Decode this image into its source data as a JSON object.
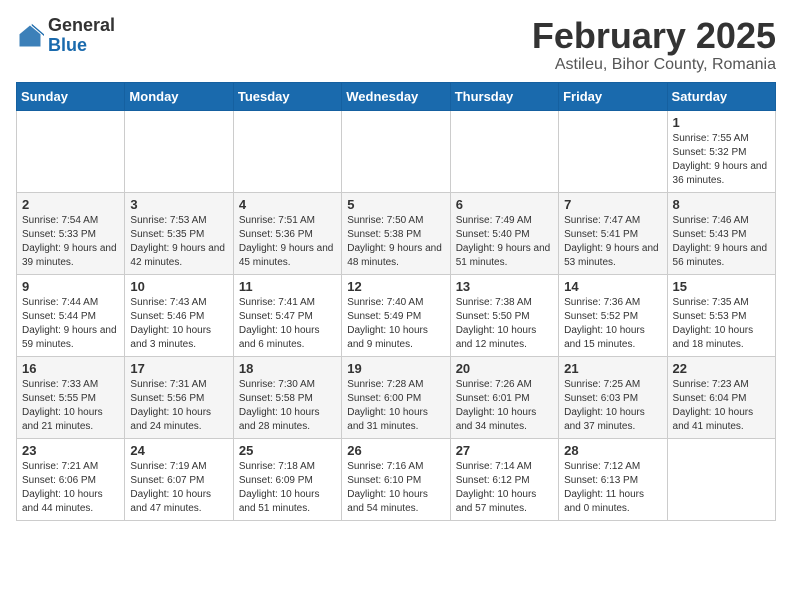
{
  "header": {
    "logo_general": "General",
    "logo_blue": "Blue",
    "month_title": "February 2025",
    "location": "Astileu, Bihor County, Romania"
  },
  "weekdays": [
    "Sunday",
    "Monday",
    "Tuesday",
    "Wednesday",
    "Thursday",
    "Friday",
    "Saturday"
  ],
  "weeks": [
    [
      {
        "day": "",
        "info": ""
      },
      {
        "day": "",
        "info": ""
      },
      {
        "day": "",
        "info": ""
      },
      {
        "day": "",
        "info": ""
      },
      {
        "day": "",
        "info": ""
      },
      {
        "day": "",
        "info": ""
      },
      {
        "day": "1",
        "info": "Sunrise: 7:55 AM\nSunset: 5:32 PM\nDaylight: 9 hours and 36 minutes."
      }
    ],
    [
      {
        "day": "2",
        "info": "Sunrise: 7:54 AM\nSunset: 5:33 PM\nDaylight: 9 hours and 39 minutes."
      },
      {
        "day": "3",
        "info": "Sunrise: 7:53 AM\nSunset: 5:35 PM\nDaylight: 9 hours and 42 minutes."
      },
      {
        "day": "4",
        "info": "Sunrise: 7:51 AM\nSunset: 5:36 PM\nDaylight: 9 hours and 45 minutes."
      },
      {
        "day": "5",
        "info": "Sunrise: 7:50 AM\nSunset: 5:38 PM\nDaylight: 9 hours and 48 minutes."
      },
      {
        "day": "6",
        "info": "Sunrise: 7:49 AM\nSunset: 5:40 PM\nDaylight: 9 hours and 51 minutes."
      },
      {
        "day": "7",
        "info": "Sunrise: 7:47 AM\nSunset: 5:41 PM\nDaylight: 9 hours and 53 minutes."
      },
      {
        "day": "8",
        "info": "Sunrise: 7:46 AM\nSunset: 5:43 PM\nDaylight: 9 hours and 56 minutes."
      }
    ],
    [
      {
        "day": "9",
        "info": "Sunrise: 7:44 AM\nSunset: 5:44 PM\nDaylight: 9 hours and 59 minutes."
      },
      {
        "day": "10",
        "info": "Sunrise: 7:43 AM\nSunset: 5:46 PM\nDaylight: 10 hours and 3 minutes."
      },
      {
        "day": "11",
        "info": "Sunrise: 7:41 AM\nSunset: 5:47 PM\nDaylight: 10 hours and 6 minutes."
      },
      {
        "day": "12",
        "info": "Sunrise: 7:40 AM\nSunset: 5:49 PM\nDaylight: 10 hours and 9 minutes."
      },
      {
        "day": "13",
        "info": "Sunrise: 7:38 AM\nSunset: 5:50 PM\nDaylight: 10 hours and 12 minutes."
      },
      {
        "day": "14",
        "info": "Sunrise: 7:36 AM\nSunset: 5:52 PM\nDaylight: 10 hours and 15 minutes."
      },
      {
        "day": "15",
        "info": "Sunrise: 7:35 AM\nSunset: 5:53 PM\nDaylight: 10 hours and 18 minutes."
      }
    ],
    [
      {
        "day": "16",
        "info": "Sunrise: 7:33 AM\nSunset: 5:55 PM\nDaylight: 10 hours and 21 minutes."
      },
      {
        "day": "17",
        "info": "Sunrise: 7:31 AM\nSunset: 5:56 PM\nDaylight: 10 hours and 24 minutes."
      },
      {
        "day": "18",
        "info": "Sunrise: 7:30 AM\nSunset: 5:58 PM\nDaylight: 10 hours and 28 minutes."
      },
      {
        "day": "19",
        "info": "Sunrise: 7:28 AM\nSunset: 6:00 PM\nDaylight: 10 hours and 31 minutes."
      },
      {
        "day": "20",
        "info": "Sunrise: 7:26 AM\nSunset: 6:01 PM\nDaylight: 10 hours and 34 minutes."
      },
      {
        "day": "21",
        "info": "Sunrise: 7:25 AM\nSunset: 6:03 PM\nDaylight: 10 hours and 37 minutes."
      },
      {
        "day": "22",
        "info": "Sunrise: 7:23 AM\nSunset: 6:04 PM\nDaylight: 10 hours and 41 minutes."
      }
    ],
    [
      {
        "day": "23",
        "info": "Sunrise: 7:21 AM\nSunset: 6:06 PM\nDaylight: 10 hours and 44 minutes."
      },
      {
        "day": "24",
        "info": "Sunrise: 7:19 AM\nSunset: 6:07 PM\nDaylight: 10 hours and 47 minutes."
      },
      {
        "day": "25",
        "info": "Sunrise: 7:18 AM\nSunset: 6:09 PM\nDaylight: 10 hours and 51 minutes."
      },
      {
        "day": "26",
        "info": "Sunrise: 7:16 AM\nSunset: 6:10 PM\nDaylight: 10 hours and 54 minutes."
      },
      {
        "day": "27",
        "info": "Sunrise: 7:14 AM\nSunset: 6:12 PM\nDaylight: 10 hours and 57 minutes."
      },
      {
        "day": "28",
        "info": "Sunrise: 7:12 AM\nSunset: 6:13 PM\nDaylight: 11 hours and 0 minutes."
      },
      {
        "day": "",
        "info": ""
      }
    ]
  ]
}
